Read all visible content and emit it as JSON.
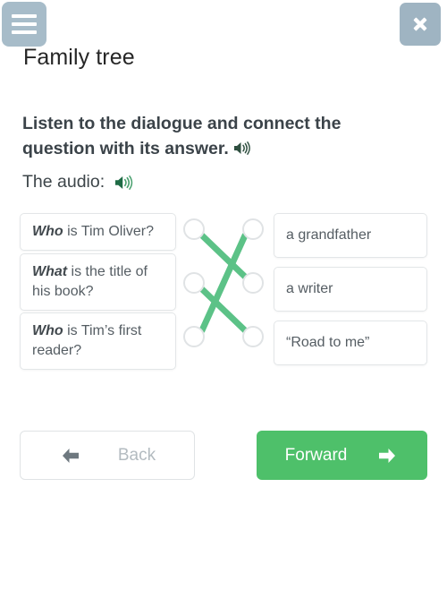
{
  "header": {
    "menu_icon": "hamburger-menu-icon",
    "close_icon": "close-x-icon",
    "title": "Family tree"
  },
  "instruction": {
    "text": "Listen to the dialogue and connect the question with its answer.",
    "speaker_icon": "speaker-icon",
    "audio_label": "The audio:",
    "audio_speaker_icon": "speaker-icon"
  },
  "exercise": {
    "questions": [
      {
        "keyword": "Who",
        "rest": " is Tim Oliver?"
      },
      {
        "keyword": "What",
        "rest": " is the title of his book?"
      },
      {
        "keyword": "Who",
        "rest": " is Tim’s first reader?"
      }
    ],
    "answers": [
      {
        "text": "a grandfather"
      },
      {
        "text": "a writer"
      },
      {
        "text": "“Road to me”"
      }
    ],
    "connections": [
      {
        "from": 1,
        "to": 2
      },
      {
        "from": 2,
        "to": 3
      },
      {
        "from": 3,
        "to": 1
      }
    ],
    "line_color": "#5cc287",
    "dot_border_color": "#e0e3e5"
  },
  "footer": {
    "back_label": "Back",
    "back_icon": "arrow-left-icon",
    "forward_label": "Forward",
    "forward_icon": "arrow-right-icon",
    "forward_color": "#4ec06a"
  }
}
